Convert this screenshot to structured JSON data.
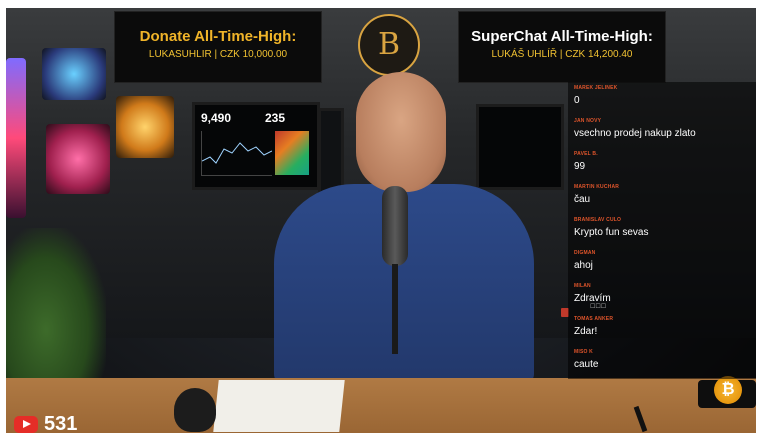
{
  "banners": {
    "donate": {
      "title": "Donate All-Time-High:",
      "subtitle": "LUKASUHLIR | CZK 10,000.00"
    },
    "superchat": {
      "title": "SuperChat All-Time-High:",
      "subtitle": "LUKÁŠ UHLÍŘ | CZK 14,200.40"
    }
  },
  "logo": {
    "glyph": "B"
  },
  "monitor": {
    "stat1": "9,490",
    "stat2": "235"
  },
  "chat": {
    "messages": [
      {
        "user": "MAREK JELINEK",
        "text": "0"
      },
      {
        "user": "JAN NOVY",
        "text": "vsechno prodej nakup zlato"
      },
      {
        "user": "PAVEL B.",
        "text": "99"
      },
      {
        "user": "MARTIN KUCHAR",
        "text": "čau"
      },
      {
        "user": "BRANISLAV CULO",
        "text": "Krypto fun sevas"
      },
      {
        "user": "DIGMAN",
        "text": "ahoj"
      },
      {
        "user": "MILAN",
        "text": "Zdravím",
        "extra": "☐☐☐"
      },
      {
        "user": "TOMAS ANKER",
        "text": "Zdar!"
      },
      {
        "user": "MISO K",
        "text": "caute"
      }
    ]
  },
  "viewers": {
    "count": "531"
  },
  "coin": {
    "glyph": "₿"
  },
  "colors": {
    "accent_gold": "#f0b429",
    "chat_user": "#e0552b",
    "youtube_red": "#e52d27"
  }
}
